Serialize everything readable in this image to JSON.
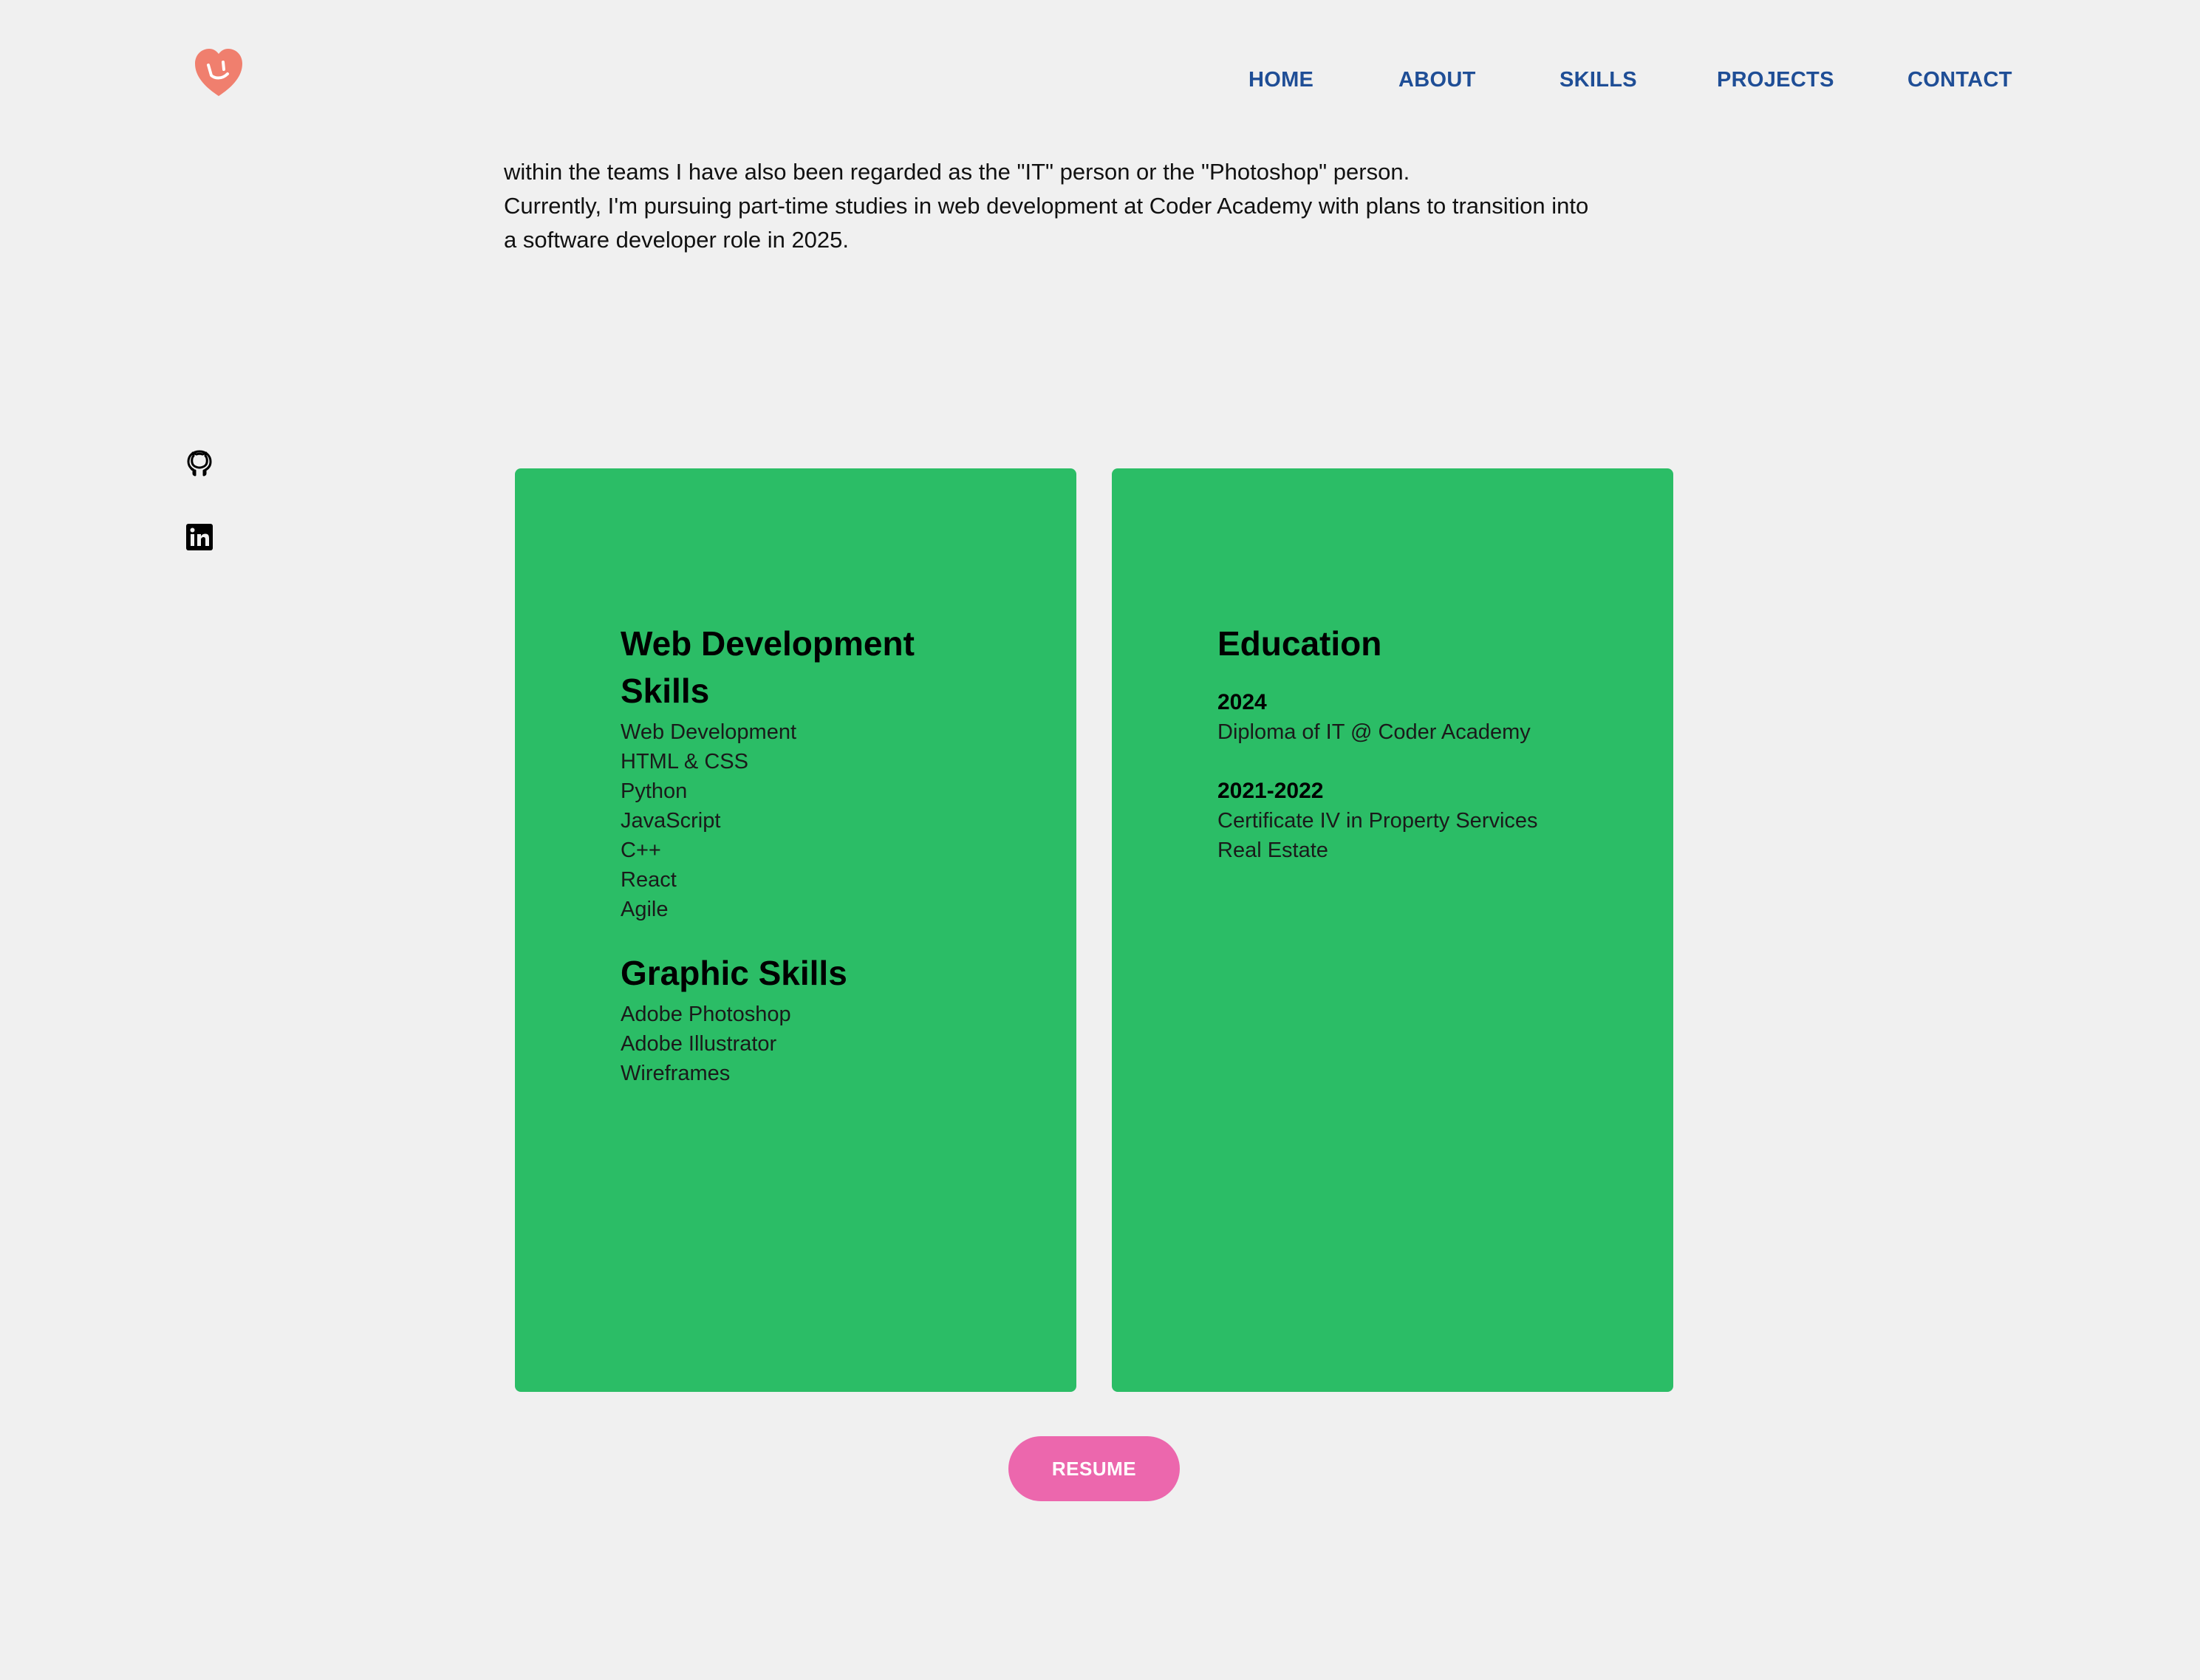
{
  "brand": {
    "logo_icon": "heart-smile-logo-icon",
    "logo_color": "#f07f6e"
  },
  "nav": {
    "items": [
      {
        "label": "HOME"
      },
      {
        "label": "ABOUT"
      },
      {
        "label": "SKILLS"
      },
      {
        "label": "PROJECTS"
      },
      {
        "label": "CONTACT"
      }
    ],
    "color": "#1f4e96"
  },
  "bio": {
    "lines": [
      "within the teams I have also been regarded as the \"IT\" person or the \"Photoshop\" person.",
      "Currently, I'm pursuing part-time studies in web development at Coder Academy with plans to transition into",
      "a software developer role in 2025."
    ]
  },
  "social": {
    "github_icon": "github-icon",
    "linkedin_icon": "linkedin-icon"
  },
  "skills_card": {
    "web_heading_line1": "Web Development",
    "web_heading_line2": "Skills",
    "web_skills": [
      "Web Development",
      "HTML & CSS",
      "Python",
      "JavaScript",
      "C++",
      "React",
      "Agile"
    ],
    "graphic_heading": "Graphic Skills",
    "graphic_skills": [
      "Adobe Photoshop",
      "Adobe Illustrator",
      "Wireframes"
    ]
  },
  "education_card": {
    "heading": "Education",
    "items": [
      {
        "year": "2024",
        "lines": [
          "Diploma of IT @ Coder Academy"
        ]
      },
      {
        "year": "2021-2022",
        "lines": [
          "Certificate IV in Property Services",
          "Real Estate"
        ]
      }
    ]
  },
  "cards_color": "#2bbd66",
  "resume": {
    "label": "RESUME",
    "color": "#ec67ad"
  }
}
